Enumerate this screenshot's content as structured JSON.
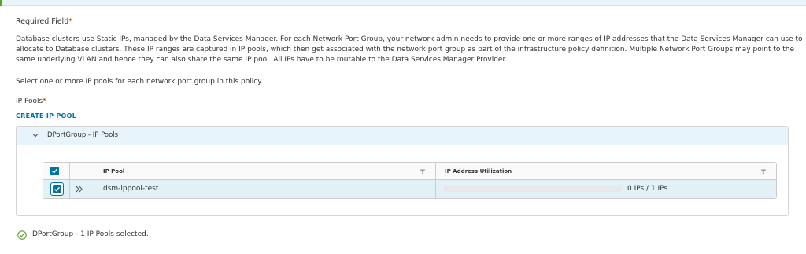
{
  "required_field": {
    "label": "Required Field",
    "marker": "*"
  },
  "description": "Database clusters use Static IPs, managed by the Data Services Manager. For each Network Port Group, your network admin needs to provide one or more ranges of IP addresses that the Data Services Manager can use to allocate to Database clusters. These IP ranges are captured in IP pools, which then get associated with the network port group as part of the infrastructure policy definition. Multiple Network Port Groups may point to the same underlying VLAN and hence they can also share the same IP pool. All IPs have to be routable to the Data Services Manager Provider.",
  "select_hint": "Select one or more IP pools for each network port group in this policy.",
  "ip_pools": {
    "label": "IP Pools",
    "marker": "*"
  },
  "create_link": "CREATE IP POOL",
  "group": {
    "title": "DPortGroup - IP Pools",
    "columns": [
      "IP Pool",
      "IP Address Utilization"
    ],
    "rows": [
      {
        "name": "dsm-ippool-test",
        "utilization": "0 IPs / 1 IPs",
        "utilization_fraction": 0,
        "selected": true
      }
    ]
  },
  "status": {
    "text": "DPortGroup - 1 IP Pools selected."
  },
  "colors": {
    "accent": "#0072a3",
    "success": "#5aa220",
    "required": "#c92100",
    "selected_row": "#e1f1f6"
  },
  "icons": [
    "chevron-down-icon",
    "filter-icon",
    "expand-row-icon",
    "checkmark-icon",
    "success-circle-icon"
  ]
}
